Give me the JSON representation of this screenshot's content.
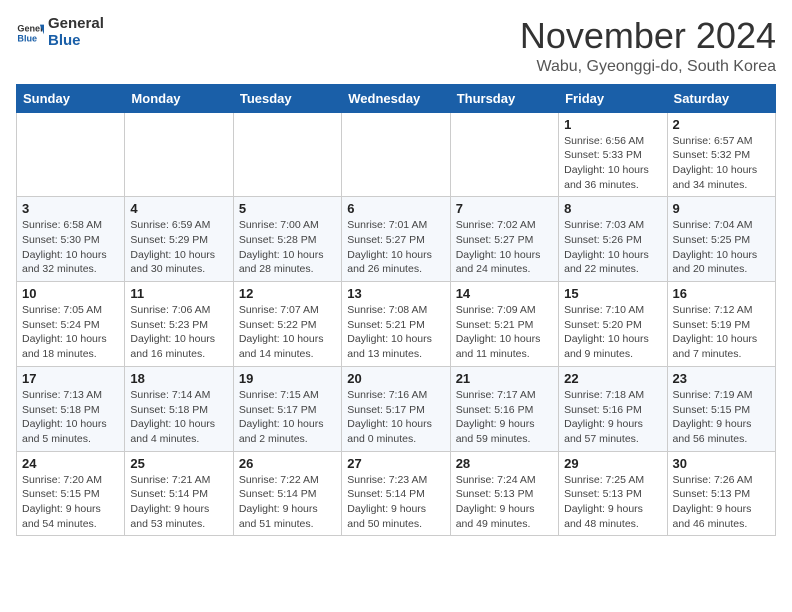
{
  "logo": {
    "general": "General",
    "blue": "Blue"
  },
  "title": "November 2024",
  "location": "Wabu, Gyeonggi-do, South Korea",
  "days_of_week": [
    "Sunday",
    "Monday",
    "Tuesday",
    "Wednesday",
    "Thursday",
    "Friday",
    "Saturday"
  ],
  "weeks": [
    [
      {
        "day": "",
        "info": ""
      },
      {
        "day": "",
        "info": ""
      },
      {
        "day": "",
        "info": ""
      },
      {
        "day": "",
        "info": ""
      },
      {
        "day": "",
        "info": ""
      },
      {
        "day": "1",
        "info": "Sunrise: 6:56 AM\nSunset: 5:33 PM\nDaylight: 10 hours and 36 minutes."
      },
      {
        "day": "2",
        "info": "Sunrise: 6:57 AM\nSunset: 5:32 PM\nDaylight: 10 hours and 34 minutes."
      }
    ],
    [
      {
        "day": "3",
        "info": "Sunrise: 6:58 AM\nSunset: 5:30 PM\nDaylight: 10 hours and 32 minutes."
      },
      {
        "day": "4",
        "info": "Sunrise: 6:59 AM\nSunset: 5:29 PM\nDaylight: 10 hours and 30 minutes."
      },
      {
        "day": "5",
        "info": "Sunrise: 7:00 AM\nSunset: 5:28 PM\nDaylight: 10 hours and 28 minutes."
      },
      {
        "day": "6",
        "info": "Sunrise: 7:01 AM\nSunset: 5:27 PM\nDaylight: 10 hours and 26 minutes."
      },
      {
        "day": "7",
        "info": "Sunrise: 7:02 AM\nSunset: 5:27 PM\nDaylight: 10 hours and 24 minutes."
      },
      {
        "day": "8",
        "info": "Sunrise: 7:03 AM\nSunset: 5:26 PM\nDaylight: 10 hours and 22 minutes."
      },
      {
        "day": "9",
        "info": "Sunrise: 7:04 AM\nSunset: 5:25 PM\nDaylight: 10 hours and 20 minutes."
      }
    ],
    [
      {
        "day": "10",
        "info": "Sunrise: 7:05 AM\nSunset: 5:24 PM\nDaylight: 10 hours and 18 minutes."
      },
      {
        "day": "11",
        "info": "Sunrise: 7:06 AM\nSunset: 5:23 PM\nDaylight: 10 hours and 16 minutes."
      },
      {
        "day": "12",
        "info": "Sunrise: 7:07 AM\nSunset: 5:22 PM\nDaylight: 10 hours and 14 minutes."
      },
      {
        "day": "13",
        "info": "Sunrise: 7:08 AM\nSunset: 5:21 PM\nDaylight: 10 hours and 13 minutes."
      },
      {
        "day": "14",
        "info": "Sunrise: 7:09 AM\nSunset: 5:21 PM\nDaylight: 10 hours and 11 minutes."
      },
      {
        "day": "15",
        "info": "Sunrise: 7:10 AM\nSunset: 5:20 PM\nDaylight: 10 hours and 9 minutes."
      },
      {
        "day": "16",
        "info": "Sunrise: 7:12 AM\nSunset: 5:19 PM\nDaylight: 10 hours and 7 minutes."
      }
    ],
    [
      {
        "day": "17",
        "info": "Sunrise: 7:13 AM\nSunset: 5:18 PM\nDaylight: 10 hours and 5 minutes."
      },
      {
        "day": "18",
        "info": "Sunrise: 7:14 AM\nSunset: 5:18 PM\nDaylight: 10 hours and 4 minutes."
      },
      {
        "day": "19",
        "info": "Sunrise: 7:15 AM\nSunset: 5:17 PM\nDaylight: 10 hours and 2 minutes."
      },
      {
        "day": "20",
        "info": "Sunrise: 7:16 AM\nSunset: 5:17 PM\nDaylight: 10 hours and 0 minutes."
      },
      {
        "day": "21",
        "info": "Sunrise: 7:17 AM\nSunset: 5:16 PM\nDaylight: 9 hours and 59 minutes."
      },
      {
        "day": "22",
        "info": "Sunrise: 7:18 AM\nSunset: 5:16 PM\nDaylight: 9 hours and 57 minutes."
      },
      {
        "day": "23",
        "info": "Sunrise: 7:19 AM\nSunset: 5:15 PM\nDaylight: 9 hours and 56 minutes."
      }
    ],
    [
      {
        "day": "24",
        "info": "Sunrise: 7:20 AM\nSunset: 5:15 PM\nDaylight: 9 hours and 54 minutes."
      },
      {
        "day": "25",
        "info": "Sunrise: 7:21 AM\nSunset: 5:14 PM\nDaylight: 9 hours and 53 minutes."
      },
      {
        "day": "26",
        "info": "Sunrise: 7:22 AM\nSunset: 5:14 PM\nDaylight: 9 hours and 51 minutes."
      },
      {
        "day": "27",
        "info": "Sunrise: 7:23 AM\nSunset: 5:14 PM\nDaylight: 9 hours and 50 minutes."
      },
      {
        "day": "28",
        "info": "Sunrise: 7:24 AM\nSunset: 5:13 PM\nDaylight: 9 hours and 49 minutes."
      },
      {
        "day": "29",
        "info": "Sunrise: 7:25 AM\nSunset: 5:13 PM\nDaylight: 9 hours and 48 minutes."
      },
      {
        "day": "30",
        "info": "Sunrise: 7:26 AM\nSunset: 5:13 PM\nDaylight: 9 hours and 46 minutes."
      }
    ]
  ]
}
